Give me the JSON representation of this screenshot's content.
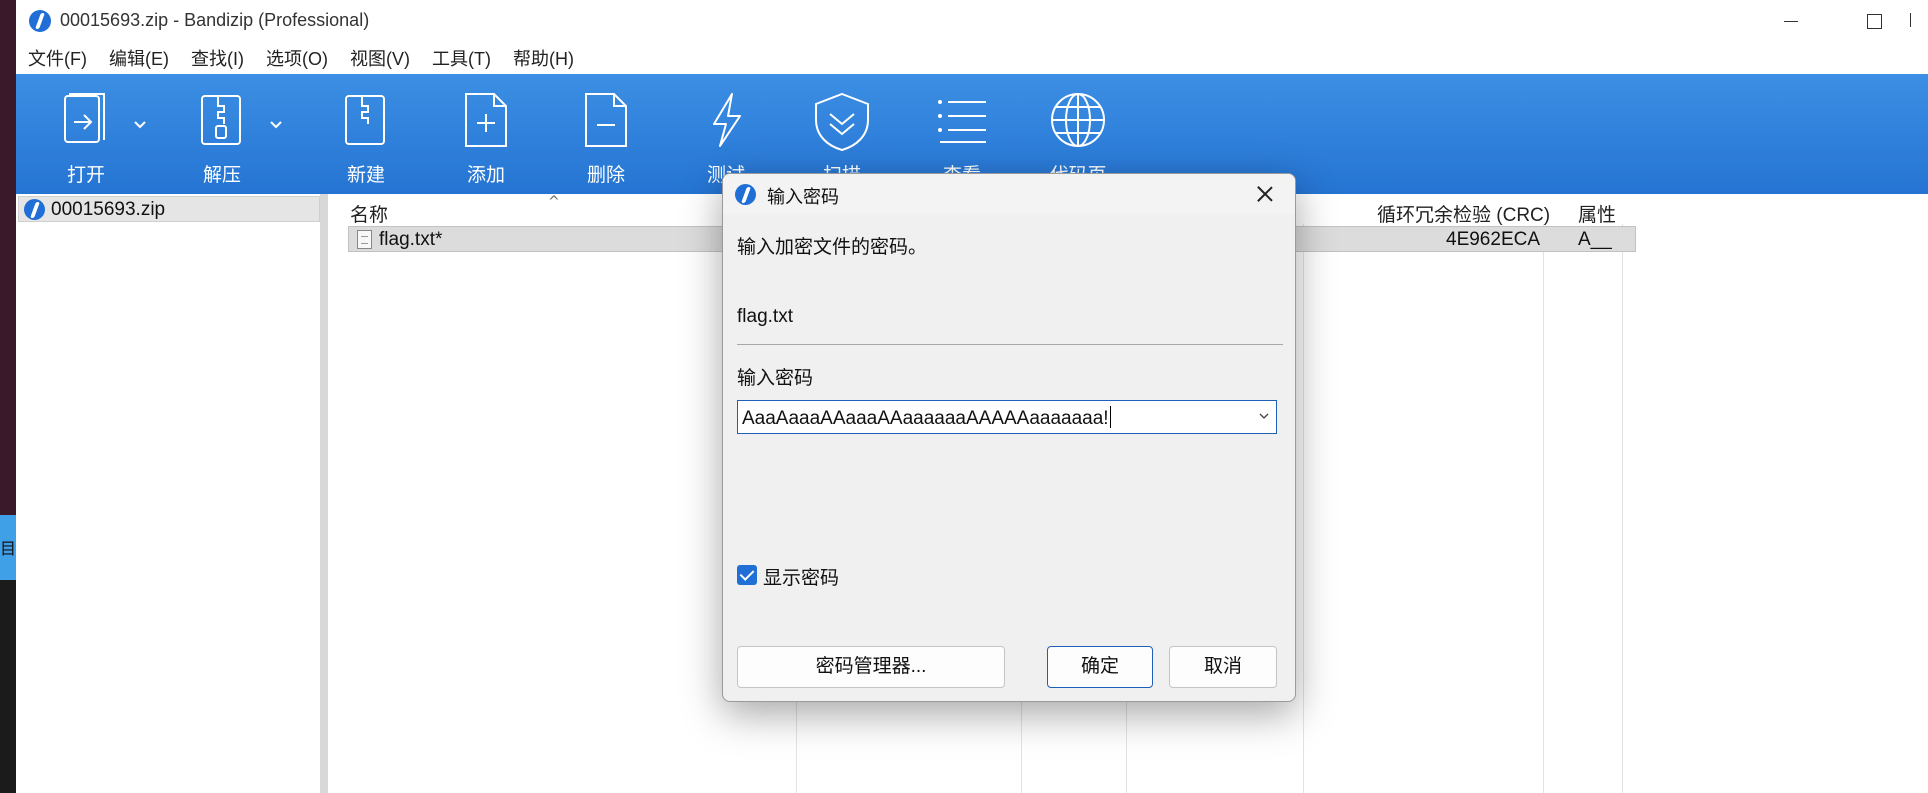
{
  "window": {
    "title": "00015693.zip - Bandizip (Professional)"
  },
  "desktop": {
    "edge_glyph": "目"
  },
  "menu": {
    "items": [
      "文件(F)",
      "编辑(E)",
      "查找(I)",
      "选项(O)",
      "视图(V)",
      "工具(T)",
      "帮助(H)"
    ]
  },
  "toolbar": {
    "open": "打开",
    "extract": "解压",
    "new": "新建",
    "add": "添加",
    "delete": "删除",
    "test": "测试",
    "scan": "扫描",
    "view": "查看",
    "codepage": "代码页"
  },
  "tree": {
    "archive": "00015693.zip"
  },
  "filelist": {
    "headers": {
      "name": "名称",
      "crc": "循环冗余检验 (CRC)",
      "attr": "属性"
    },
    "rows": [
      {
        "name": "flag.txt*",
        "crc": "4E962ECA",
        "attr": "A__"
      }
    ]
  },
  "dialog": {
    "title": "输入密码",
    "message": "输入加密文件的密码。",
    "filename": "flag.txt",
    "password_label": "输入密码",
    "password_value": "AaaAaaaAAaaaAAaaaaaaAAAAAaaaaaaa!",
    "show_password_label": "显示密码",
    "show_password_checked": true,
    "buttons": {
      "password_manager": "密码管理器...",
      "ok": "确定",
      "cancel": "取消"
    }
  },
  "colors": {
    "toolbar": "#2f80dc",
    "accent": "#1f6fd6",
    "dialog_bg": "#f0f0f0"
  }
}
